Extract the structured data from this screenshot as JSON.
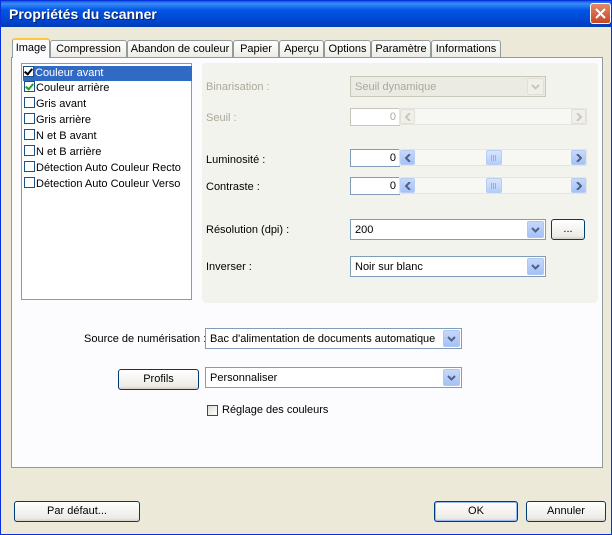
{
  "window": {
    "title": "Propriétés du scanner"
  },
  "tabs": [
    {
      "label": "Image",
      "active": true
    },
    {
      "label": "Compression"
    },
    {
      "label": "Abandon de couleur"
    },
    {
      "label": "Papier"
    },
    {
      "label": "Aperçu"
    },
    {
      "label": "Options"
    },
    {
      "label": "Paramètre"
    },
    {
      "label": "Informations"
    }
  ],
  "image_list": [
    {
      "label": "Couleur avant",
      "checked": true,
      "selected": true
    },
    {
      "label": "Couleur arrière",
      "checked": true
    },
    {
      "label": "Gris avant",
      "checked": false
    },
    {
      "label": "Gris arrière",
      "checked": false
    },
    {
      "label": "N et B avant",
      "checked": false
    },
    {
      "label": "N et B arrière",
      "checked": false
    },
    {
      "label": "Détection Auto Couleur Recto",
      "checked": false
    },
    {
      "label": "Détection Auto Couleur Verso",
      "checked": false
    }
  ],
  "settings": {
    "binarisation": {
      "label": "Binarisation :",
      "value": "Seuil dynamique"
    },
    "seuil": {
      "label": "Seuil :",
      "value": "0"
    },
    "luminosite": {
      "label": "Luminosité :",
      "value": "0",
      "position": 0.5
    },
    "contraste": {
      "label": "Contraste :",
      "value": "0",
      "position": 0.5
    },
    "resolution": {
      "label": "Résolution (dpi) :",
      "value": "200",
      "more_label": "..."
    },
    "inverser": {
      "label": "Inverser :",
      "value": "Noir sur blanc"
    }
  },
  "source": {
    "label": "Source de numérisation :",
    "value": "Bac d'alimentation de documents automatique"
  },
  "profils": {
    "button_label": "Profils",
    "value": "Personnaliser"
  },
  "color_adjust": {
    "label": "Réglage des couleurs",
    "checked": false
  },
  "footer": {
    "default_label": "Par défaut...",
    "ok_label": "OK",
    "cancel_label": "Annuler"
  }
}
